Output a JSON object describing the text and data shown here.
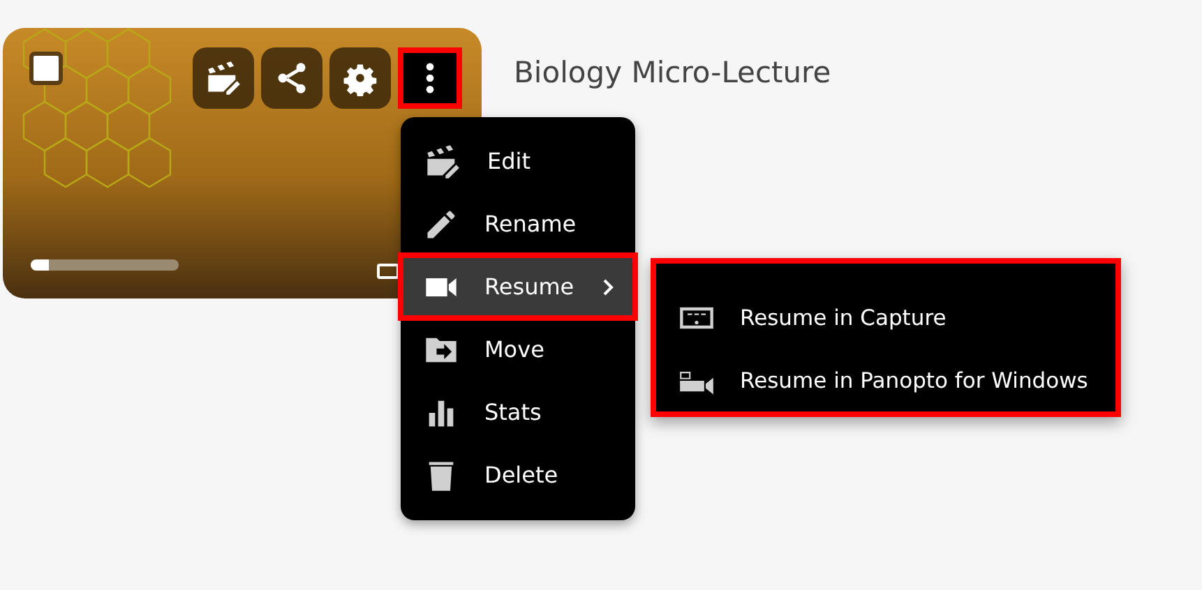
{
  "video": {
    "selected": false,
    "progress": {
      "level": 0.12
    },
    "captions": true,
    "actions": [
      {
        "kind": "edit",
        "highlighted": false
      },
      {
        "kind": "share",
        "highlighted": false
      },
      {
        "kind": "settings",
        "highlighted": false
      },
      {
        "kind": "more",
        "highlighted": true
      }
    ]
  },
  "title": "Biology Micro-Lecture",
  "menu": {
    "items": [
      {
        "label": "Edit",
        "kind": "edit",
        "selected": false,
        "submenu": false,
        "highlighted": false
      },
      {
        "label": "Rename",
        "kind": "rename",
        "selected": false,
        "submenu": false,
        "highlighted": false
      },
      {
        "label": "Resume",
        "kind": "camera",
        "selected": true,
        "submenu": true,
        "highlighted": true
      },
      {
        "label": "Move",
        "kind": "move",
        "selected": false,
        "submenu": false,
        "highlighted": false
      },
      {
        "label": "Stats",
        "kind": "stats",
        "selected": false,
        "submenu": false,
        "highlighted": false
      },
      {
        "label": "Delete",
        "kind": "delete",
        "selected": false,
        "submenu": false,
        "highlighted": false
      }
    ]
  },
  "submenu": {
    "highlighted": true,
    "items": [
      {
        "label": "Resume in Capture",
        "kind": "capture"
      },
      {
        "label": "Resume in Panopto for Windows",
        "kind": "windows"
      }
    ]
  }
}
